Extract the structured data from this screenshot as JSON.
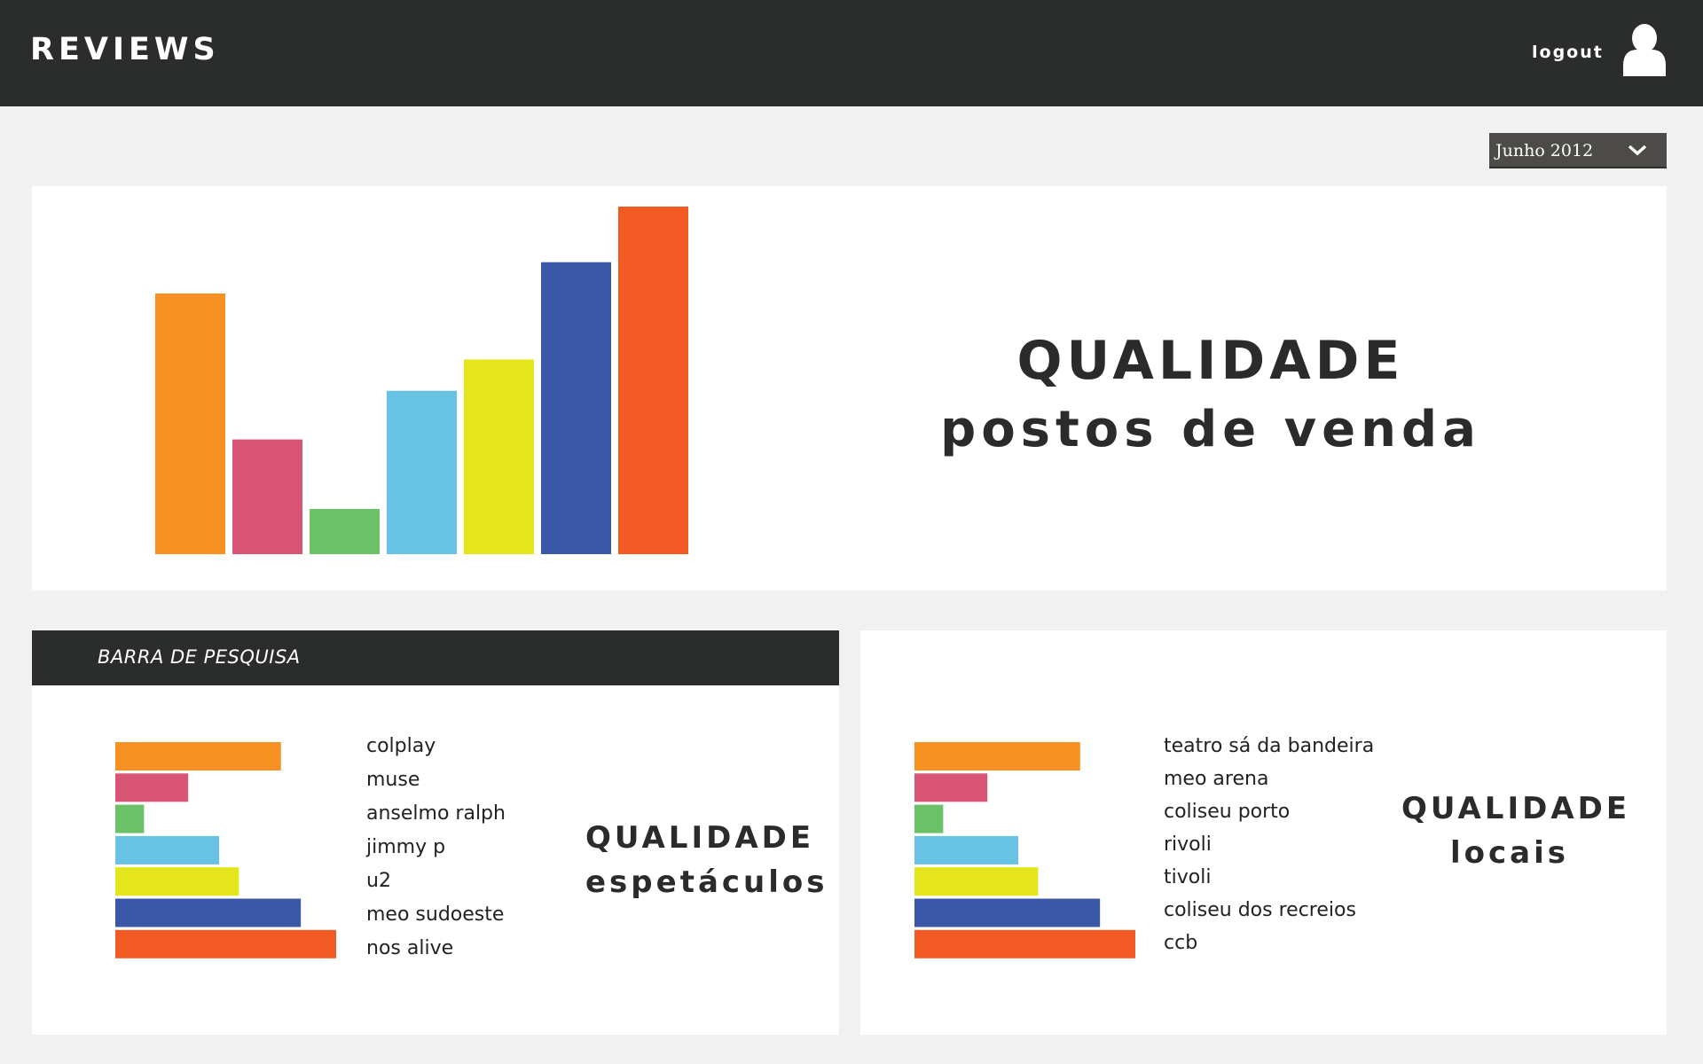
{
  "header": {
    "app_title": "REVIEWS",
    "logout_label": "logout",
    "avatar_icon": "user-icon"
  },
  "date_filter": {
    "selected": "Junho 2012",
    "icon": "chevron-down-icon"
  },
  "top_panel": {
    "title": "QUALIDADE",
    "subtitle": "postos de venda"
  },
  "search": {
    "label": "BARRA DE PESQUISA"
  },
  "left_panel": {
    "title": "QUALIDADE",
    "subtitle": "espetáculos"
  },
  "right_panel": {
    "title": "QUALIDADE",
    "subtitle": "locais"
  },
  "colors": {
    "orange": "#f79122",
    "pink": "#d85576",
    "green": "#6ac168",
    "light_blue": "#67c2e3",
    "yellow": "#e4e51b",
    "dark_blue": "#3b57a7",
    "red_orange": "#f15b23",
    "header_bg": "#2b2c2c"
  },
  "chart_data": [
    {
      "type": "bar",
      "orientation": "vertical",
      "categories": [
        "",
        "",
        "",
        "",
        "",
        "",
        ""
      ],
      "values": [
        75,
        33,
        13,
        47,
        56,
        84,
        100
      ],
      "ylim": [
        0,
        100
      ],
      "colors": [
        "#f79122",
        "#d85576",
        "#6ac168",
        "#67c2e3",
        "#e4e51b",
        "#3b57a7",
        "#f15b23"
      ]
    },
    {
      "type": "bar",
      "orientation": "horizontal",
      "categories": [
        "colplay",
        "muse",
        "anselmo ralph",
        "jimmy p",
        "u2",
        "meo sudoeste",
        "nos alive"
      ],
      "values": [
        75,
        33,
        13,
        47,
        56,
        84,
        100
      ],
      "xlim": [
        0,
        100
      ],
      "colors": [
        "#f79122",
        "#d85576",
        "#6ac168",
        "#67c2e3",
        "#e4e51b",
        "#3b57a7",
        "#f15b23"
      ]
    },
    {
      "type": "bar",
      "orientation": "horizontal",
      "categories": [
        "teatro sá da bandeira",
        "meo arena",
        "coliseu porto",
        "rivoli",
        "tivoli",
        "coliseu dos recreios",
        "ccb"
      ],
      "values": [
        75,
        33,
        13,
        47,
        56,
        84,
        100
      ],
      "xlim": [
        0,
        100
      ],
      "colors": [
        "#f79122",
        "#d85576",
        "#6ac168",
        "#67c2e3",
        "#e4e51b",
        "#3b57a7",
        "#f15b23"
      ]
    }
  ]
}
